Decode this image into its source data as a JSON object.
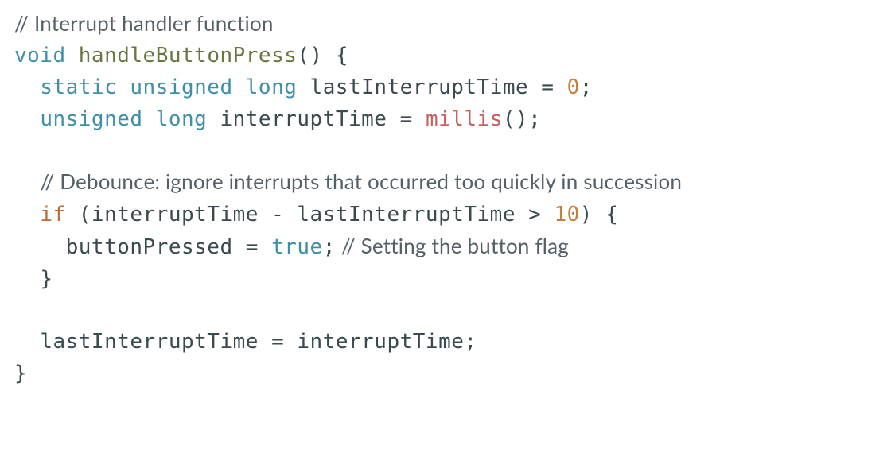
{
  "code": {
    "comment_header": "// Interrupt handler function",
    "kw_void": "void",
    "fn_name": "handleButtonPress",
    "fn_parens_open": "() {",
    "kw_static": "static",
    "kw_unsigned_long_1": "unsigned long",
    "var_lastInterruptTime_decl": "lastInterruptTime",
    "eq1": " = ",
    "num_zero": "0",
    "semi1": ";",
    "kw_unsigned_long_2": "unsigned long",
    "var_interruptTime_decl": "interruptTime",
    "eq2": " = ",
    "call_millis": "millis",
    "call_millis_parens": "();",
    "comment_debounce": "// Debounce: ignore interrupts that occurred too quickly in succession",
    "kw_if": "if",
    "if_open": " (interruptTime - lastInterruptTime > ",
    "num_ten": "10",
    "if_close": ") {",
    "assign_buttonPressed": "buttonPressed = ",
    "kw_true": "true",
    "semi2": ";",
    "comment_setflag": " // Setting the button flag",
    "brace_close_inner": "}",
    "assign_last": "lastInterruptTime = interruptTime;",
    "brace_close_outer": "}"
  }
}
